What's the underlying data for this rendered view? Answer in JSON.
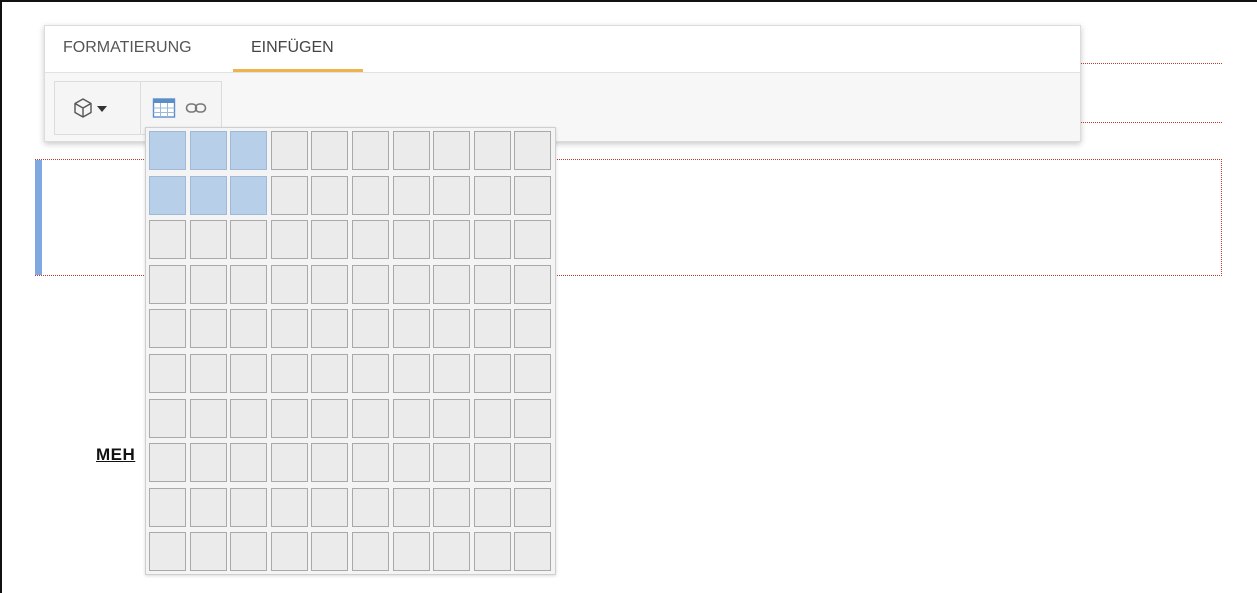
{
  "tabs": [
    {
      "label": "FORMATIERUNG",
      "active": false
    },
    {
      "label": "EINFÜGEN",
      "active": true
    }
  ],
  "accent_color": "#f0b24a",
  "toolbar_icons": [
    "cube-icon",
    "caret-down-icon",
    "table-icon",
    "link-icon"
  ],
  "table_picker": {
    "columns": 10,
    "rows": 10,
    "highlighted_columns": 3,
    "highlighted_rows": 2,
    "highlight_color": "#b7cfe8"
  },
  "content": {
    "more_link": "MEH"
  }
}
